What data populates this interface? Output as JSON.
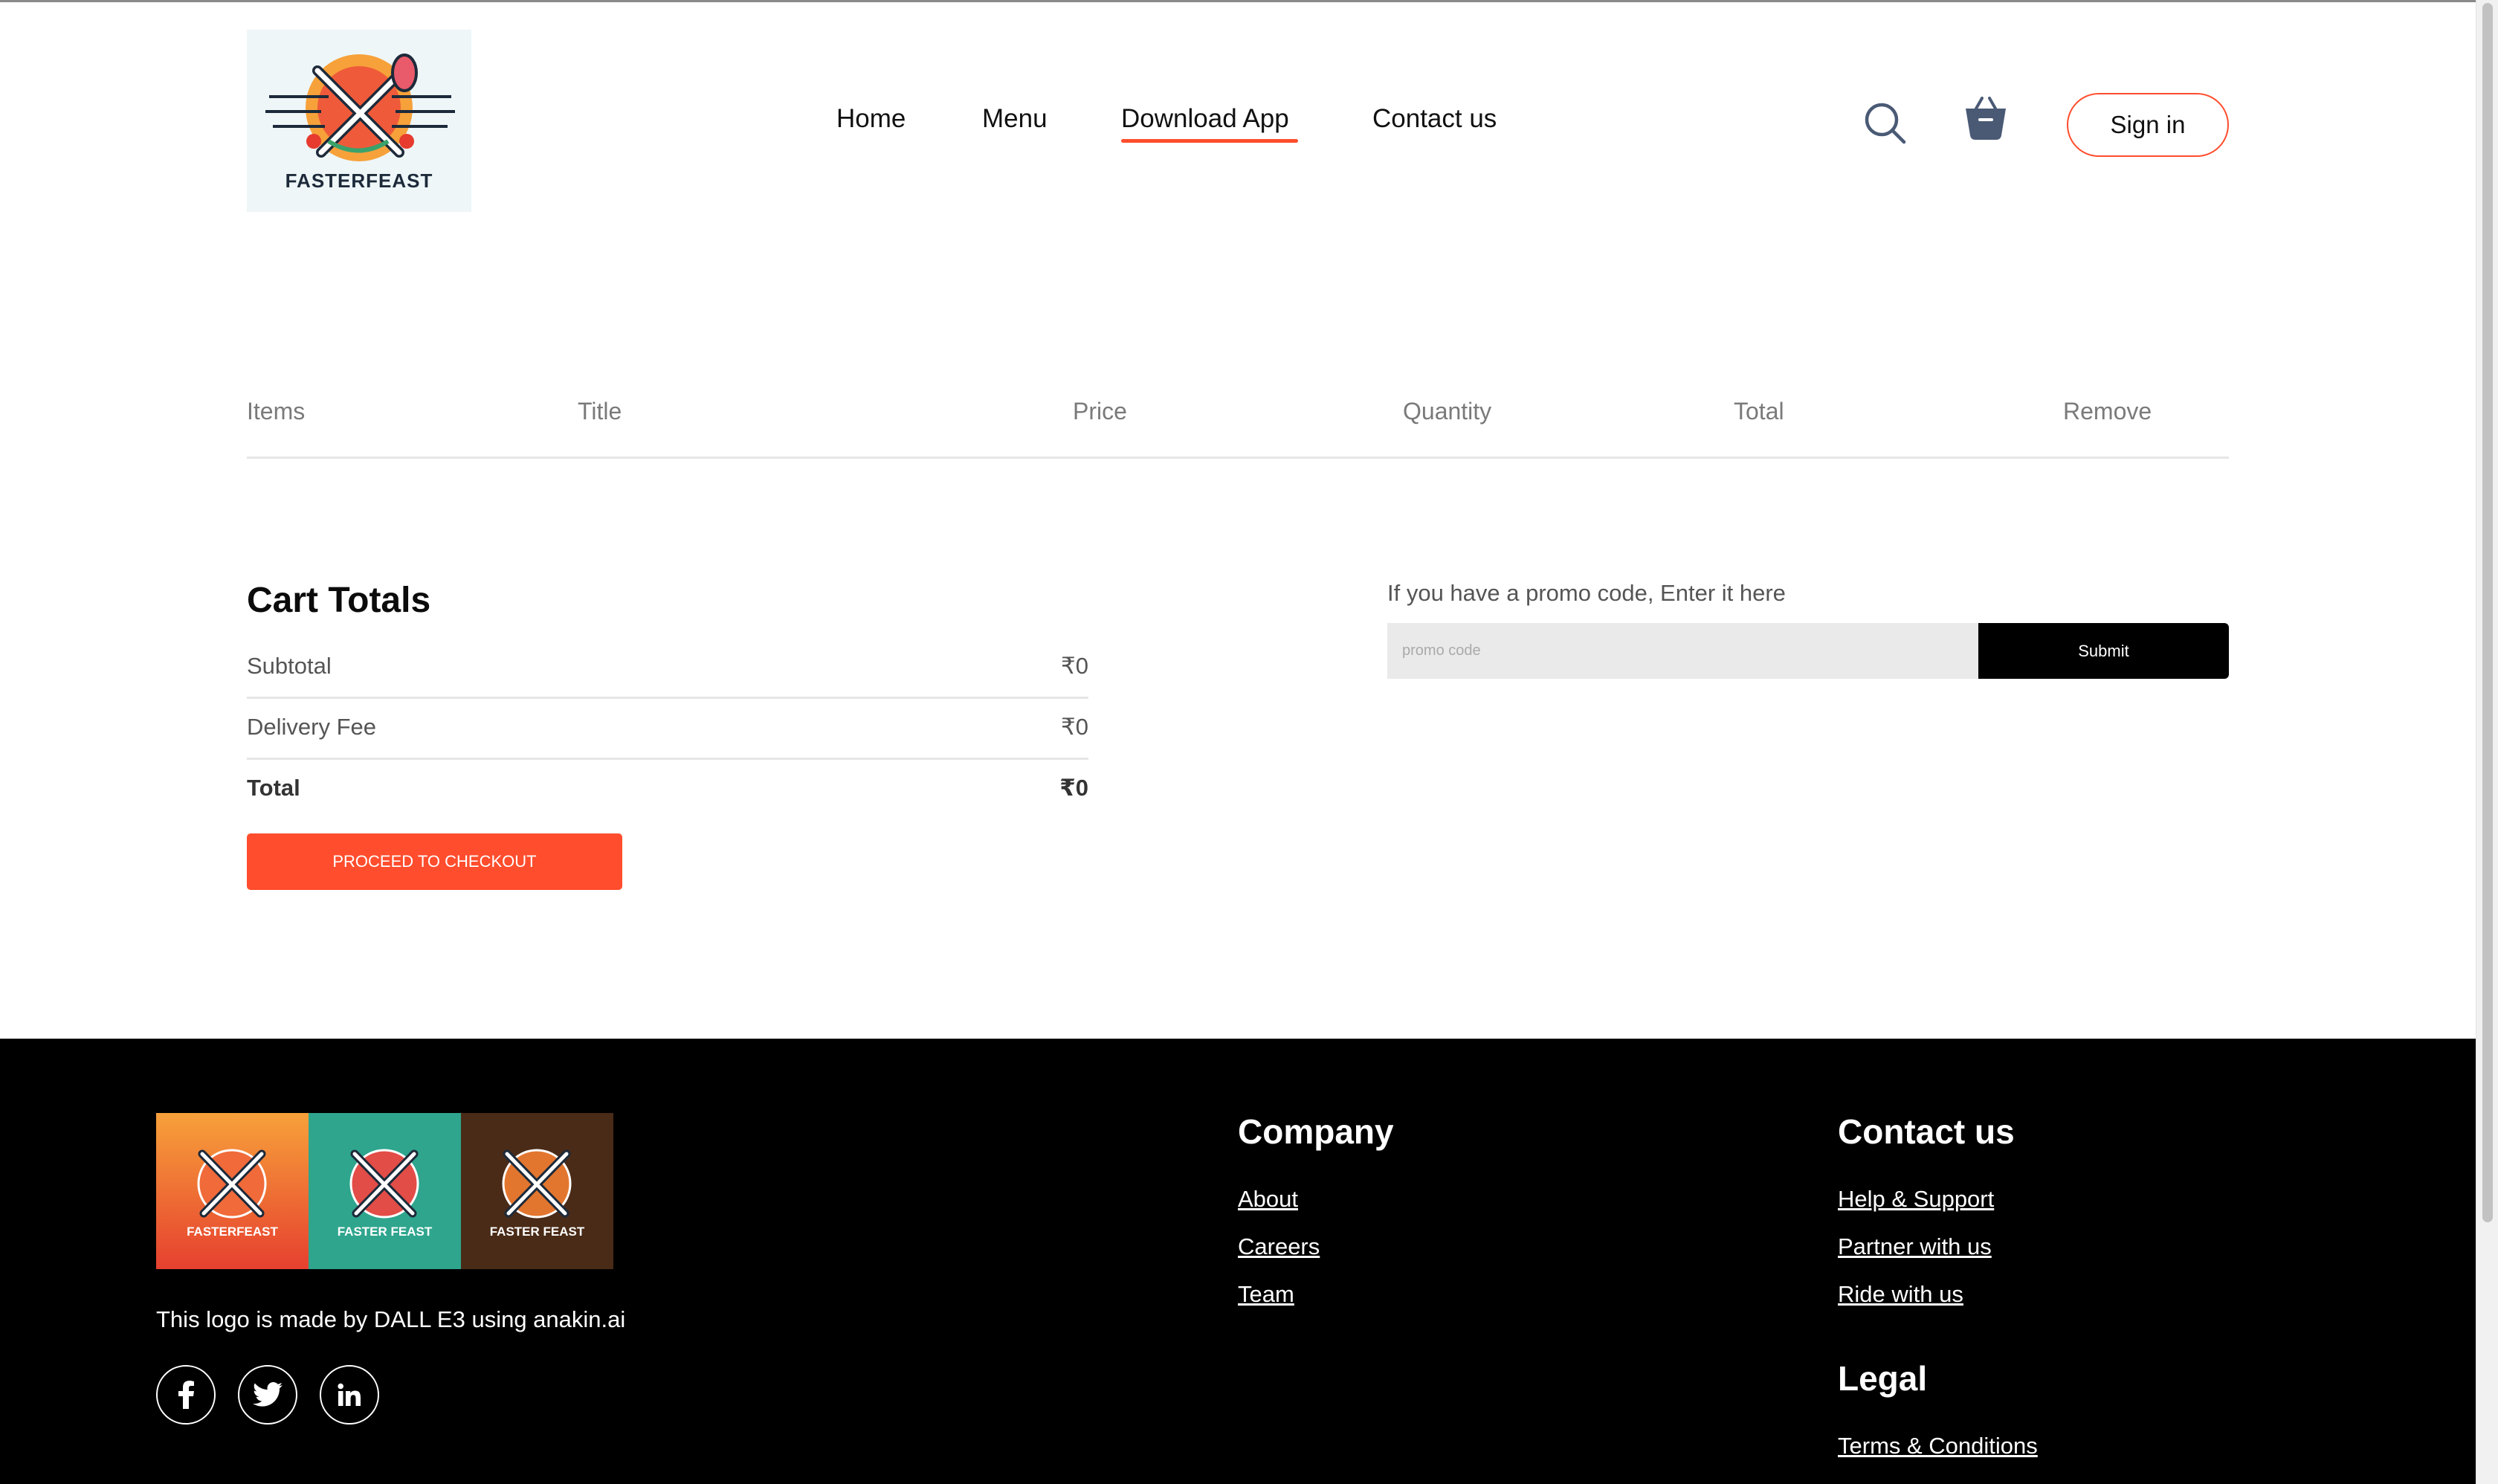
{
  "brand": {
    "name": "FASTERFEAST"
  },
  "nav": {
    "items": [
      {
        "label": "Home"
      },
      {
        "label": "Menu"
      },
      {
        "label": "Download App"
      },
      {
        "label": "Contact us"
      }
    ],
    "active": "Download App"
  },
  "header": {
    "signin_label": "Sign in",
    "search_icon": "search-icon",
    "cart_icon": "basket-icon"
  },
  "cart_table": {
    "columns": [
      "Items",
      "Title",
      "Price",
      "Quantity",
      "Total",
      "Remove"
    ]
  },
  "cart_totals": {
    "title": "Cart Totals",
    "rows": [
      {
        "label": "Subtotal",
        "value": "₹0"
      },
      {
        "label": "Delivery Fee",
        "value": "₹0"
      },
      {
        "label": "Total",
        "value": "₹0"
      }
    ],
    "checkout_label": "PROCEED TO CHECKOUT"
  },
  "promo": {
    "label": "If you have a promo code, Enter it here",
    "placeholder": "promo code",
    "submit_label": "Submit"
  },
  "footer": {
    "logo_labels": [
      "FASTERFEAST",
      "FASTER FEAST",
      "FASTER FEAST"
    ],
    "credit": "This logo is made by DALL E3 using anakin.ai",
    "social": [
      {
        "icon": "facebook-icon",
        "glyph": "f"
      },
      {
        "icon": "twitter-icon",
        "glyph": "t"
      },
      {
        "icon": "linkedin-icon",
        "glyph": "in"
      }
    ],
    "company": {
      "heading": "Company",
      "links": [
        "About",
        "Careers",
        "Team"
      ]
    },
    "contact": {
      "heading": "Contact us",
      "links": [
        "Help & Support",
        "Partner with us",
        "Ride with us"
      ]
    },
    "legal": {
      "heading": "Legal",
      "links": [
        "Terms & Conditions"
      ]
    }
  },
  "colors": {
    "accent": "#ff4d2d",
    "footer_bg": "#000000",
    "text_muted": "#7a7a7a"
  }
}
